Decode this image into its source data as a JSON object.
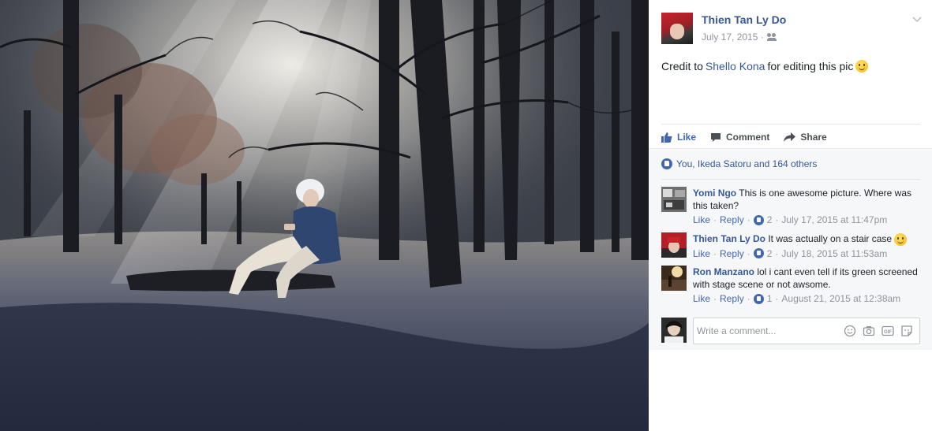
{
  "post": {
    "author": "Thien Tan Ly Do",
    "date": "July 17, 2015 ·",
    "text_before": "Credit to",
    "tagged_user": "Shello Kona",
    "text_after": "for editing this pic",
    "emoji": "smile-emoji"
  },
  "actions": {
    "like_label": "Like",
    "comment_label": "Comment",
    "share_label": "Share"
  },
  "reactions": {
    "summary": "You, Ikeda Satoru and 164 others"
  },
  "comments": [
    {
      "author": "Yomi Ngo",
      "text": "This is one awesome picture. Where was this taken?",
      "like_label": "Like",
      "reply_label": "Reply",
      "like_count": "2",
      "timestamp": "July 17, 2015 at 11:47pm"
    },
    {
      "author": "Thien Tan Ly Do",
      "text": "It was actually on a stair case",
      "like_label": "Like",
      "reply_label": "Reply",
      "like_count": "2",
      "timestamp": "July 18, 2015 at 11:53am"
    },
    {
      "author": "Ron Manzano",
      "text": "lol i cant even tell if its green screened with stage scene or not awsome.",
      "like_label": "Like",
      "reply_label": "Reply",
      "like_count": "1",
      "timestamp": "August 21, 2015 at 12:38am"
    }
  ],
  "composer": {
    "placeholder": "Write a comment..."
  },
  "colors": {
    "link": "#365899",
    "accent": "#4267b2",
    "meta": "#90949c",
    "panel_bg": "#f6f7f9"
  },
  "icons": [
    "audience-friends-icon",
    "chevron-down-icon",
    "like-thumb-icon",
    "comment-bubble-icon",
    "share-arrow-icon",
    "emoji-icon",
    "camera-icon",
    "gif-icon",
    "sticker-icon"
  ]
}
